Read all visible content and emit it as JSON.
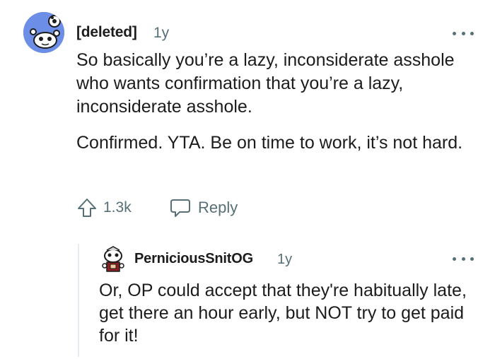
{
  "comment": {
    "author": "[deleted]",
    "age": "1y",
    "paragraphs": [
      "So basically you’re a lazy, inconsiderate asshole who wants confirmation that you’re a lazy, inconsiderate asshole.",
      "Confirmed. YTA. Be on time to work, it’s not hard."
    ],
    "upvote_icon": "upvote-arrow-icon",
    "vote_count": "1.3k",
    "reply_icon": "speech-bubble-icon",
    "reply_label": "Reply",
    "more_icon": "more-dots-icon"
  },
  "reply": {
    "author": "PerniciousSnitOG",
    "age": "1y",
    "text": "Or, OP could accept that they're habitually late, get there an hour early, but NOT try to get paid for it!",
    "more_icon": "more-dots-icon"
  },
  "colors": {
    "avatar_bg": "#6c8ee6",
    "meta_gray": "#576f76",
    "text": "#1c1c1c",
    "thread_line": "#e5ebee"
  }
}
